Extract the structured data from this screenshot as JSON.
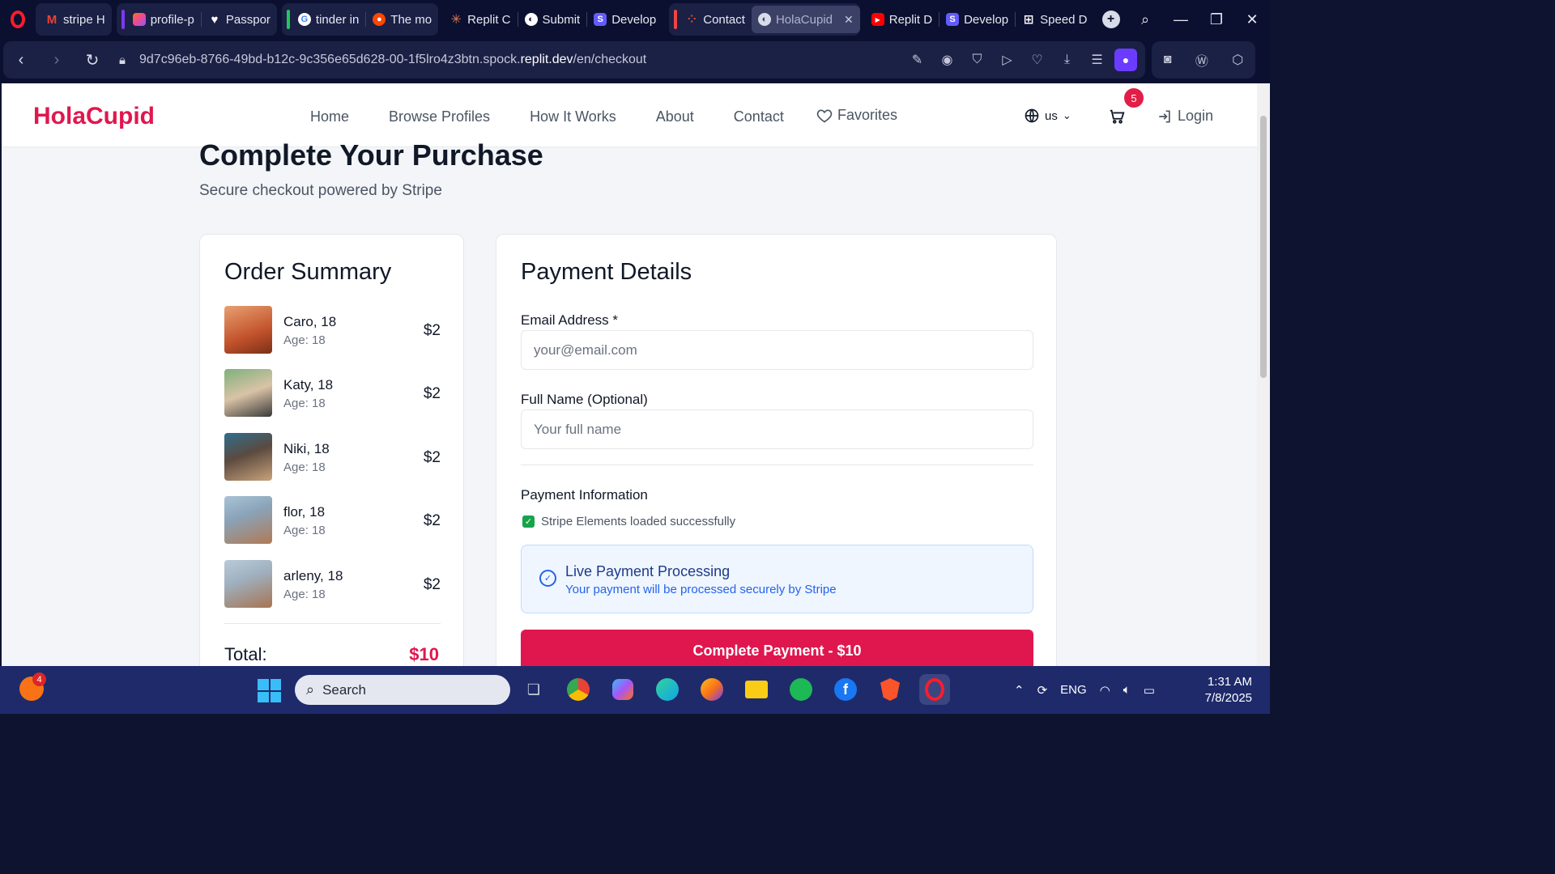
{
  "browser": {
    "tabs": [
      {
        "label": "stripe H",
        "favicon": "gmail-icon"
      },
      {
        "label": "profile-p",
        "favicon": "lovable-icon"
      },
      {
        "label": "Passpor",
        "favicon": "heart-icon"
      },
      {
        "label": "tinder in",
        "favicon": "google-icon"
      },
      {
        "label": "The mo",
        "favicon": "reddit-icon"
      },
      {
        "label": "Replit C",
        "favicon": "claude-icon"
      },
      {
        "label": "Submit",
        "favicon": "globe-icon"
      },
      {
        "label": "Develop",
        "favicon": "stripe-icon"
      },
      {
        "label": "Contact",
        "favicon": "figma-icon"
      },
      {
        "label": "HolaCupid",
        "favicon": "globe-icon"
      },
      {
        "label": "Replit D",
        "favicon": "youtube-icon"
      },
      {
        "label": "Develop",
        "favicon": "stripe-icon"
      },
      {
        "label": "Speed D",
        "favicon": "grid-icon"
      }
    ],
    "active_tab_index": 9,
    "url": "9d7c96eb-8766-49bd-b12c-9c356e65d628-00-1f5lro4z3btn.spock.",
    "url_domain": "replit.dev",
    "url_path": "/en/checkout"
  },
  "site": {
    "brand": "HolaCupid",
    "nav": [
      "Home",
      "Browse Profiles",
      "How It Works",
      "About",
      "Contact"
    ],
    "favorites": "Favorites",
    "lang": "us",
    "cart_count": "5",
    "login": "Login"
  },
  "page": {
    "title": "Complete Your Purchase",
    "subtitle": "Secure checkout powered by Stripe"
  },
  "summary": {
    "heading": "Order Summary",
    "items": [
      {
        "name": "Caro, 18",
        "age": "Age: 18",
        "price": "$2",
        "color": "#c2522b"
      },
      {
        "name": "Katy, 18",
        "age": "Age: 18",
        "price": "$2",
        "color": "#b9a48a"
      },
      {
        "name": "Niki, 18",
        "age": "Age: 18",
        "price": "$2",
        "color": "#5b4a3f"
      },
      {
        "name": "flor, 18",
        "age": "Age: 18",
        "price": "$2",
        "color": "#8aa3b8"
      },
      {
        "name": "arleny, 18",
        "age": "Age: 18",
        "price": "$2",
        "color": "#9fb0bf"
      }
    ],
    "total_label": "Total:",
    "total_value": "$10"
  },
  "payment": {
    "heading": "Payment Details",
    "email_label": "Email Address *",
    "email_placeholder": "your@email.com",
    "name_label": "Full Name (Optional)",
    "name_placeholder": "Your full name",
    "info_label": "Payment Information",
    "stripe_status": "Stripe Elements loaded successfully",
    "live_title": "Live Payment Processing",
    "live_sub": "Your payment will be processed securely by Stripe",
    "button": "Complete Payment - $10"
  },
  "taskbar": {
    "widget_badge": "4",
    "search": "Search",
    "lang": "ENG",
    "time": "1:31 AM",
    "date": "7/8/2025"
  },
  "colors": {
    "brand": "#e0174f",
    "accent_blue": "#2563eb",
    "success": "#16a34a"
  }
}
